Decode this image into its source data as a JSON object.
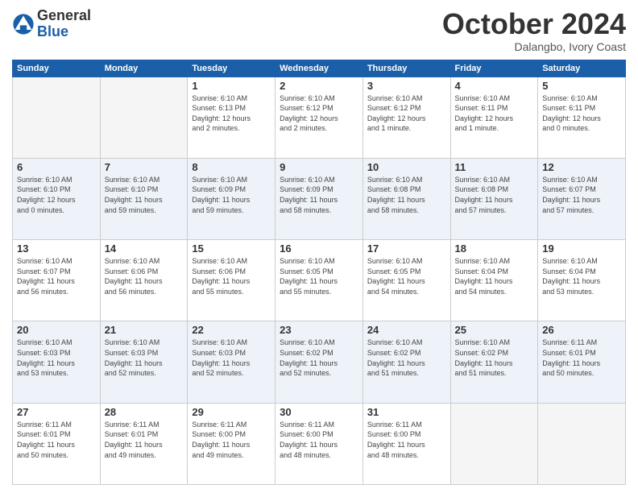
{
  "logo": {
    "general": "General",
    "blue": "Blue"
  },
  "header": {
    "month": "October 2024",
    "location": "Dalangbo, Ivory Coast"
  },
  "weekdays": [
    "Sunday",
    "Monday",
    "Tuesday",
    "Wednesday",
    "Thursday",
    "Friday",
    "Saturday"
  ],
  "weeks": [
    [
      {
        "day": "",
        "empty": true
      },
      {
        "day": "",
        "empty": true
      },
      {
        "day": "1",
        "info": "Sunrise: 6:10 AM\nSunset: 6:13 PM\nDaylight: 12 hours\nand 2 minutes."
      },
      {
        "day": "2",
        "info": "Sunrise: 6:10 AM\nSunset: 6:12 PM\nDaylight: 12 hours\nand 2 minutes."
      },
      {
        "day": "3",
        "info": "Sunrise: 6:10 AM\nSunset: 6:12 PM\nDaylight: 12 hours\nand 1 minute."
      },
      {
        "day": "4",
        "info": "Sunrise: 6:10 AM\nSunset: 6:11 PM\nDaylight: 12 hours\nand 1 minute."
      },
      {
        "day": "5",
        "info": "Sunrise: 6:10 AM\nSunset: 6:11 PM\nDaylight: 12 hours\nand 0 minutes."
      }
    ],
    [
      {
        "day": "6",
        "info": "Sunrise: 6:10 AM\nSunset: 6:10 PM\nDaylight: 12 hours\nand 0 minutes."
      },
      {
        "day": "7",
        "info": "Sunrise: 6:10 AM\nSunset: 6:10 PM\nDaylight: 11 hours\nand 59 minutes."
      },
      {
        "day": "8",
        "info": "Sunrise: 6:10 AM\nSunset: 6:09 PM\nDaylight: 11 hours\nand 59 minutes."
      },
      {
        "day": "9",
        "info": "Sunrise: 6:10 AM\nSunset: 6:09 PM\nDaylight: 11 hours\nand 58 minutes."
      },
      {
        "day": "10",
        "info": "Sunrise: 6:10 AM\nSunset: 6:08 PM\nDaylight: 11 hours\nand 58 minutes."
      },
      {
        "day": "11",
        "info": "Sunrise: 6:10 AM\nSunset: 6:08 PM\nDaylight: 11 hours\nand 57 minutes."
      },
      {
        "day": "12",
        "info": "Sunrise: 6:10 AM\nSunset: 6:07 PM\nDaylight: 11 hours\nand 57 minutes."
      }
    ],
    [
      {
        "day": "13",
        "info": "Sunrise: 6:10 AM\nSunset: 6:07 PM\nDaylight: 11 hours\nand 56 minutes."
      },
      {
        "day": "14",
        "info": "Sunrise: 6:10 AM\nSunset: 6:06 PM\nDaylight: 11 hours\nand 56 minutes."
      },
      {
        "day": "15",
        "info": "Sunrise: 6:10 AM\nSunset: 6:06 PM\nDaylight: 11 hours\nand 55 minutes."
      },
      {
        "day": "16",
        "info": "Sunrise: 6:10 AM\nSunset: 6:05 PM\nDaylight: 11 hours\nand 55 minutes."
      },
      {
        "day": "17",
        "info": "Sunrise: 6:10 AM\nSunset: 6:05 PM\nDaylight: 11 hours\nand 54 minutes."
      },
      {
        "day": "18",
        "info": "Sunrise: 6:10 AM\nSunset: 6:04 PM\nDaylight: 11 hours\nand 54 minutes."
      },
      {
        "day": "19",
        "info": "Sunrise: 6:10 AM\nSunset: 6:04 PM\nDaylight: 11 hours\nand 53 minutes."
      }
    ],
    [
      {
        "day": "20",
        "info": "Sunrise: 6:10 AM\nSunset: 6:03 PM\nDaylight: 11 hours\nand 53 minutes."
      },
      {
        "day": "21",
        "info": "Sunrise: 6:10 AM\nSunset: 6:03 PM\nDaylight: 11 hours\nand 52 minutes."
      },
      {
        "day": "22",
        "info": "Sunrise: 6:10 AM\nSunset: 6:03 PM\nDaylight: 11 hours\nand 52 minutes."
      },
      {
        "day": "23",
        "info": "Sunrise: 6:10 AM\nSunset: 6:02 PM\nDaylight: 11 hours\nand 52 minutes."
      },
      {
        "day": "24",
        "info": "Sunrise: 6:10 AM\nSunset: 6:02 PM\nDaylight: 11 hours\nand 51 minutes."
      },
      {
        "day": "25",
        "info": "Sunrise: 6:10 AM\nSunset: 6:02 PM\nDaylight: 11 hours\nand 51 minutes."
      },
      {
        "day": "26",
        "info": "Sunrise: 6:11 AM\nSunset: 6:01 PM\nDaylight: 11 hours\nand 50 minutes."
      }
    ],
    [
      {
        "day": "27",
        "info": "Sunrise: 6:11 AM\nSunset: 6:01 PM\nDaylight: 11 hours\nand 50 minutes."
      },
      {
        "day": "28",
        "info": "Sunrise: 6:11 AM\nSunset: 6:01 PM\nDaylight: 11 hours\nand 49 minutes."
      },
      {
        "day": "29",
        "info": "Sunrise: 6:11 AM\nSunset: 6:00 PM\nDaylight: 11 hours\nand 49 minutes."
      },
      {
        "day": "30",
        "info": "Sunrise: 6:11 AM\nSunset: 6:00 PM\nDaylight: 11 hours\nand 48 minutes."
      },
      {
        "day": "31",
        "info": "Sunrise: 6:11 AM\nSunset: 6:00 PM\nDaylight: 11 hours\nand 48 minutes."
      },
      {
        "day": "",
        "empty": true
      },
      {
        "day": "",
        "empty": true
      }
    ]
  ]
}
